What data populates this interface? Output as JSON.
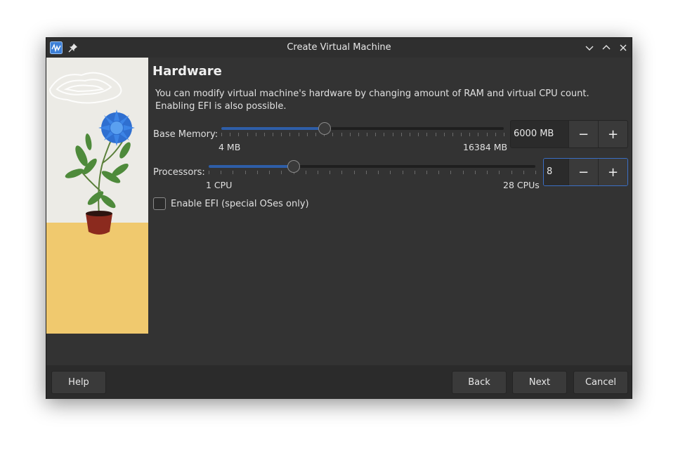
{
  "window": {
    "title": "Create Virtual Machine"
  },
  "titlebar_icons": {
    "app": "virt-manager-icon",
    "pin": "pin-icon",
    "minimize": "chevron-down-icon",
    "maximize": "chevron-up-icon",
    "close": "close-icon"
  },
  "page": {
    "heading": "Hardware",
    "description_line1": "You can modify virtual machine's hardware by changing amount of RAM and virtual CPU count.",
    "description_line2": "Enabling EFI is also possible."
  },
  "memory": {
    "label": "Base Memory:",
    "min_label": "4 MB",
    "max_label": "16384 MB",
    "value": "6000 MB",
    "min": 4,
    "max": 16384,
    "current": 6000
  },
  "processors": {
    "label": "Processors:",
    "min_label": "1 CPU",
    "max_label": "28 CPUs",
    "value": "8",
    "min": 1,
    "max": 28,
    "current": 8
  },
  "spin_buttons": {
    "decrement": "−",
    "increment": "+"
  },
  "efi": {
    "label": "Enable EFI (special OSes only)",
    "checked": false
  },
  "buttons": {
    "help": "Help",
    "back": "Back",
    "next": "Next",
    "cancel": "Cancel"
  },
  "colors": {
    "accent": "#2e5ea8",
    "window_bg": "#333333",
    "focus_border": "#3b6fc4"
  }
}
